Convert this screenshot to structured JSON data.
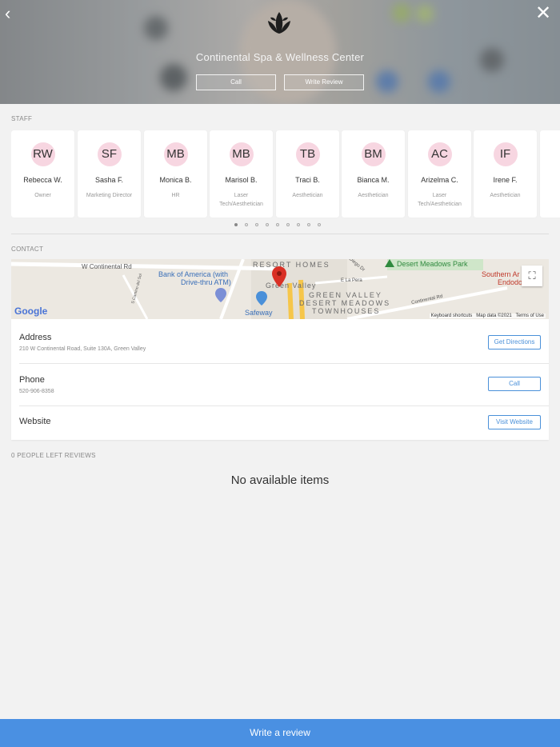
{
  "hero": {
    "business_name": "Continental Spa & Wellness Center",
    "call_label": "Call",
    "write_review_label": "Write Review"
  },
  "staff": {
    "section_label": "STAFF",
    "members": [
      {
        "initials": "RW",
        "name": "Rebecca W.",
        "role": "Owner"
      },
      {
        "initials": "SF",
        "name": "Sasha F.",
        "role": "Marketing Director"
      },
      {
        "initials": "MB",
        "name": "Monica B.",
        "role": "HR"
      },
      {
        "initials": "MB",
        "name": "Marisol B.",
        "role": "Laser Tech/Aesthetician"
      },
      {
        "initials": "TB",
        "name": "Traci B.",
        "role": "Aesthetician"
      },
      {
        "initials": "BM",
        "name": "Bianca M.",
        "role": "Aesthetician"
      },
      {
        "initials": "AC",
        "name": "Arizelma C.",
        "role": "Laser Tech/Aesthetician"
      },
      {
        "initials": "IF",
        "name": "Irene F.",
        "role": "Aesthetician"
      }
    ],
    "pages": 9,
    "active_page": 0
  },
  "contact": {
    "section_label": "CONTACT",
    "map": {
      "labels": {
        "road1": "W Continental Rd",
        "bank": "Bank of America (with",
        "bank2": "Drive-thru ATM)",
        "resort": "RESORT HOMES",
        "green_valley": "Green Valley",
        "gv_desert1": "GREEN VALLEY",
        "gv_desert2": "DESERT MEADOWS",
        "gv_desert3": "TOWNHOUSES",
        "park": "Desert Meadows Park",
        "safeway": "Safeway",
        "southern": "Southern Ar",
        "endodo": "Endodo",
        "continental_rd": "Continental Rd",
        "camino": "S Camino del Sol",
        "la_pera": "E La Pera",
        "diego": "Diego Dr"
      },
      "google": "Google",
      "keyboard_shortcuts": "Keyboard shortcuts",
      "map_data": "Map data ©2021",
      "terms": "Terms of Use"
    },
    "address_title": "Address",
    "address_value": "210 W Continental Road, Suite 130A, Green Valley",
    "directions_label": "Get Directions",
    "phone_title": "Phone",
    "phone_value": "520-906-8358",
    "call_label": "Call",
    "website_title": "Website",
    "website_label": "Visit Website"
  },
  "reviews": {
    "section_label": "0 PEOPLE LEFT REVIEWS",
    "empty_text": "No available items"
  },
  "footer": {
    "write_review_label": "Write a review"
  },
  "colors": {
    "accent": "#4a90e2",
    "avatar_bg": "#f7d6e1",
    "map_pin": "#d93025"
  }
}
